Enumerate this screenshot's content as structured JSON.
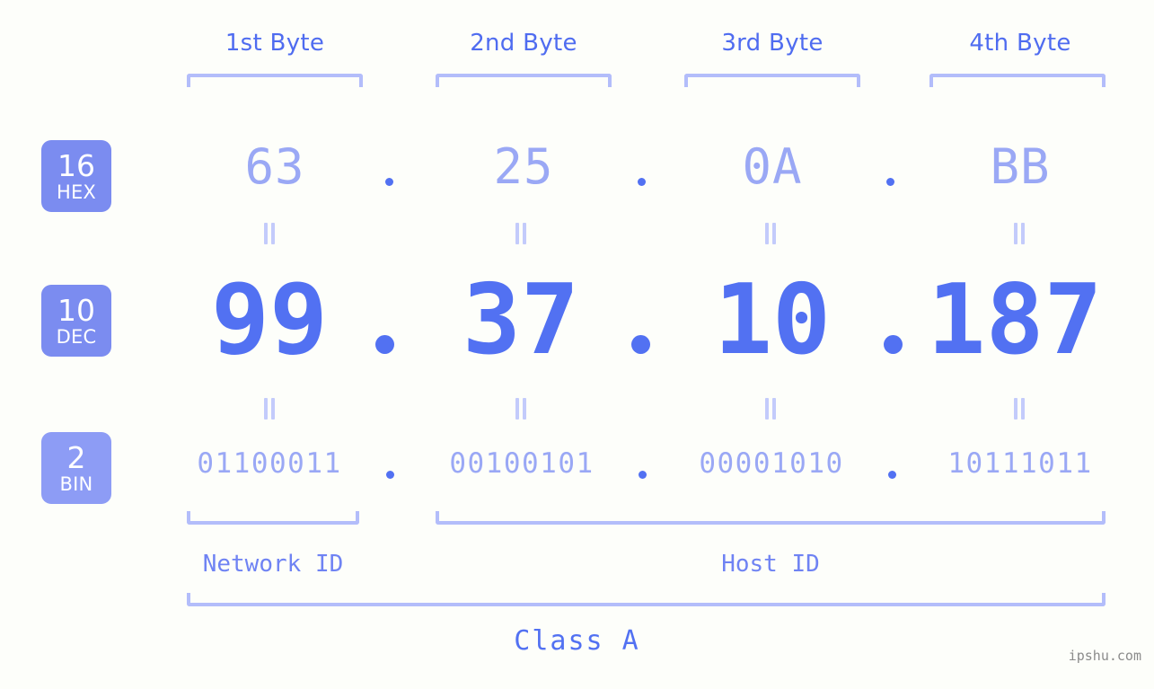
{
  "header": {
    "byte_labels": [
      "1st Byte",
      "2nd Byte",
      "3rd Byte",
      "4th Byte"
    ]
  },
  "badges": [
    {
      "num": "16",
      "name": "HEX",
      "color": "#7b8cf0"
    },
    {
      "num": "10",
      "name": "DEC",
      "color": "#7b8cf0"
    },
    {
      "num": "2",
      "name": "BIN",
      "color": "#8d9cf5"
    }
  ],
  "rows": {
    "hex": {
      "base": "16",
      "label": "HEX",
      "values": [
        "63",
        "25",
        "0A",
        "BB"
      ],
      "separator": "."
    },
    "dec": {
      "base": "10",
      "label": "DEC",
      "values": [
        "99",
        "37",
        "10",
        "187"
      ],
      "separator": "."
    },
    "bin": {
      "base": "2",
      "label": "BIN",
      "values": [
        "01100011",
        "00100101",
        "00001010",
        "10111011"
      ],
      "separator": "."
    }
  },
  "ip_address": "99.37.10.187",
  "segments": {
    "network_id": "Network ID",
    "host_id": "Host ID"
  },
  "class_label": "Class A",
  "watermark": "ipshu.com",
  "colors": {
    "background": "#fdfefa",
    "light_blue": "#9aa8f5",
    "strong_blue": "#5271f2",
    "bracket": "#b3bdfa",
    "badge_dark": "#7b8cf0",
    "badge_light": "#8d9cf5",
    "equals": "#c3cbfb",
    "watermark": "#8b8b8b"
  }
}
